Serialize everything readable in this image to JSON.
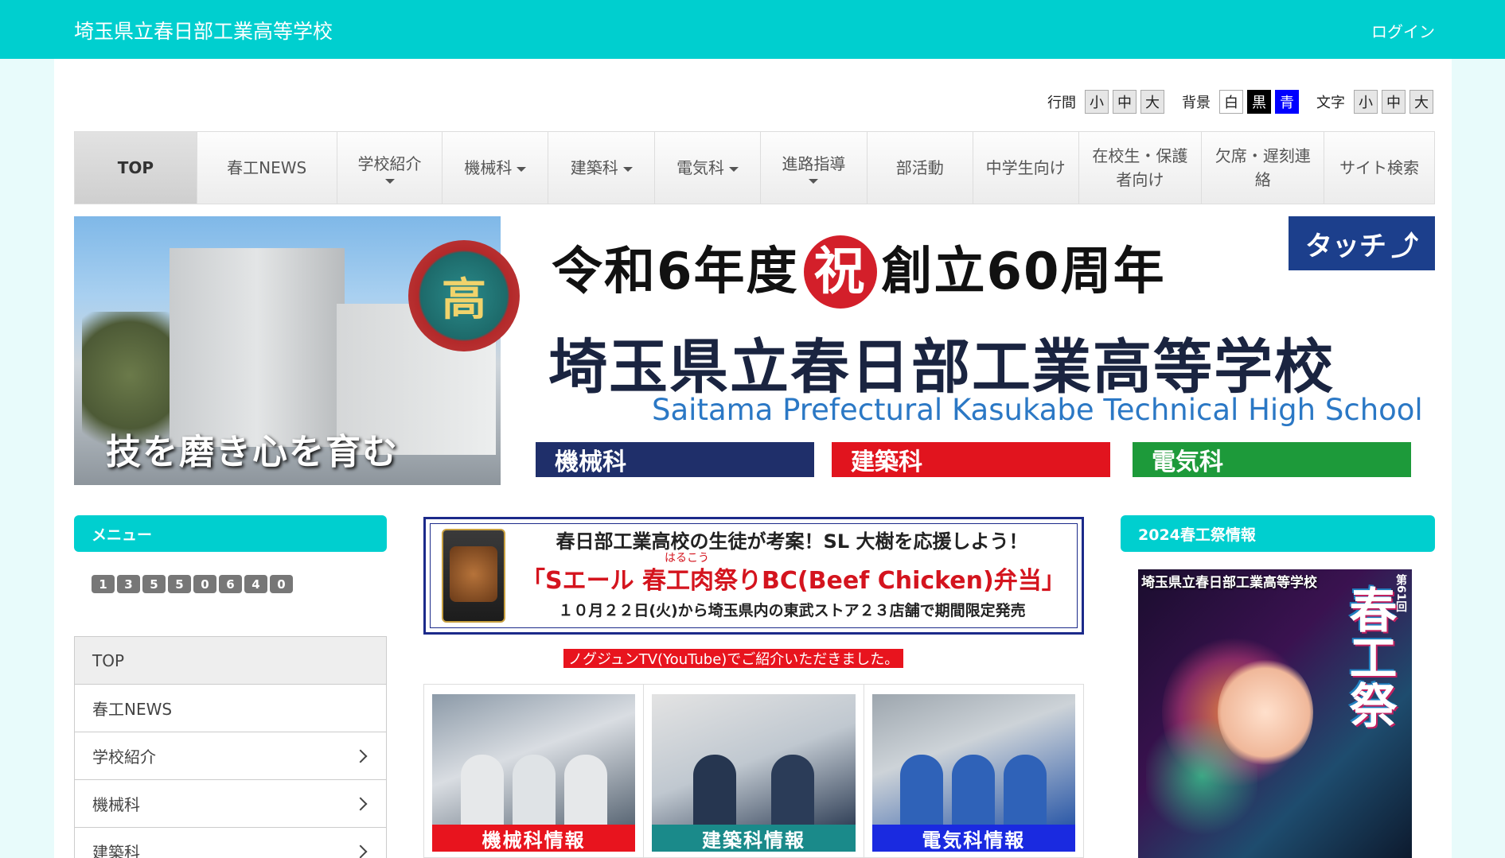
{
  "header": {
    "site_title": "埼玉県立春日部工業高等学校",
    "login": "ログイン"
  },
  "accessibility": {
    "line_spacing": {
      "label": "行間",
      "options": [
        "小",
        "中",
        "大"
      ]
    },
    "background": {
      "label": "背景",
      "options": [
        "白",
        "黒",
        "青"
      ]
    },
    "text_size": {
      "label": "文字",
      "options": [
        "小",
        "中",
        "大"
      ]
    }
  },
  "nav": [
    {
      "label": "TOP",
      "active": true
    },
    {
      "label": "春工NEWS"
    },
    {
      "label": "学校紹介",
      "dropdown": true
    },
    {
      "label": "機械科",
      "dropdown": true
    },
    {
      "label": "建築科",
      "dropdown": true
    },
    {
      "label": "電気科",
      "dropdown": true
    },
    {
      "label": "進路指導",
      "dropdown": true
    },
    {
      "label": "部活動"
    },
    {
      "label": "中学生向け"
    },
    {
      "label": "在校生・保護者向け"
    },
    {
      "label": "欠席・遅刻連絡"
    },
    {
      "label": "サイト検索"
    }
  ],
  "banner": {
    "slogan": "技を磨き心を育む",
    "emblem": "高",
    "touch": "タッチ",
    "anniversary_pre": "令和6年度",
    "anniversary_mark": "祝",
    "anniversary_post": "創立60周年",
    "school_name": "埼玉県立春日部工業高等学校",
    "school_name_en": "Saitama Prefectural Kasukabe Technical High School",
    "departments": [
      "機械科",
      "建築科",
      "電気科"
    ]
  },
  "left_sidebar": {
    "title": "メニュー",
    "counter": [
      "1",
      "3",
      "5",
      "5",
      "0",
      "6",
      "4",
      "0"
    ],
    "menu": [
      {
        "label": "TOP",
        "active": true
      },
      {
        "label": "春工NEWS"
      },
      {
        "label": "学校紹介",
        "chevron": true
      },
      {
        "label": "機械科",
        "chevron": true
      },
      {
        "label": "建築科",
        "chevron": true
      }
    ]
  },
  "promo": {
    "line1": "春日部工業高校の生徒が考案！SL 大樹を応援しよう！",
    "ruby": "はるこう",
    "line2": "「Sエール 春工肉祭りBC(Beef Chicken)弁当」",
    "line3": "１０月２２日(火)から埼玉県内の東武ストア２３店舗で期間限定発売"
  },
  "tv_link": "ノグジュンTV(YouTube)でご紹介いただきました。",
  "dept_cards": [
    "機械科情報",
    "建築科情報",
    "電気科情報"
  ],
  "right_sidebar": {
    "title": "2024春工祭情報",
    "poster_school": "埼玉県立春日部工業高等学校",
    "poster_num": "第61回",
    "poster_title": "春工祭"
  }
}
